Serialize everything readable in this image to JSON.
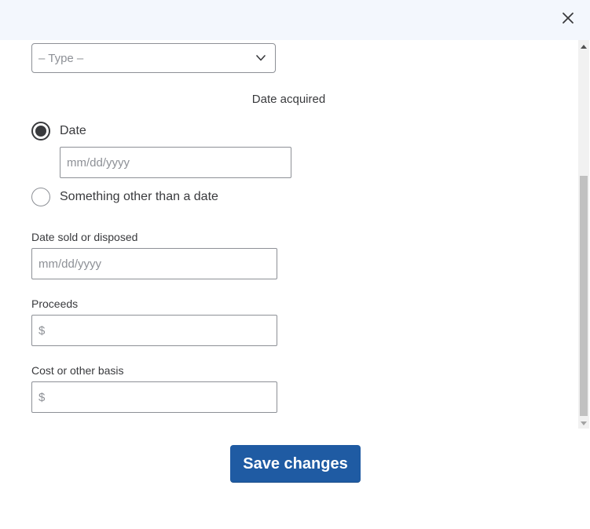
{
  "dialog": {
    "close_label": "×"
  },
  "form": {
    "type_select": {
      "value": "– Type –"
    },
    "date_acquired": {
      "heading": "Date acquired",
      "options": [
        {
          "label": "Date",
          "checked": true
        },
        {
          "label": "Something other than a date",
          "checked": false
        }
      ],
      "date_placeholder": "mm/dd/yyyy"
    },
    "date_sold": {
      "label": "Date sold or disposed",
      "placeholder": "mm/dd/yyyy"
    },
    "proceeds": {
      "label": "Proceeds",
      "placeholder": "$"
    },
    "cost_basis": {
      "label": "Cost or other basis",
      "placeholder": "$"
    }
  },
  "footer": {
    "save_label": "Save changes"
  },
  "colors": {
    "header_bg": "#f3f7fd",
    "primary": "#1f5ba3",
    "text": "#393a3d",
    "placeholder": "#8d9096"
  }
}
